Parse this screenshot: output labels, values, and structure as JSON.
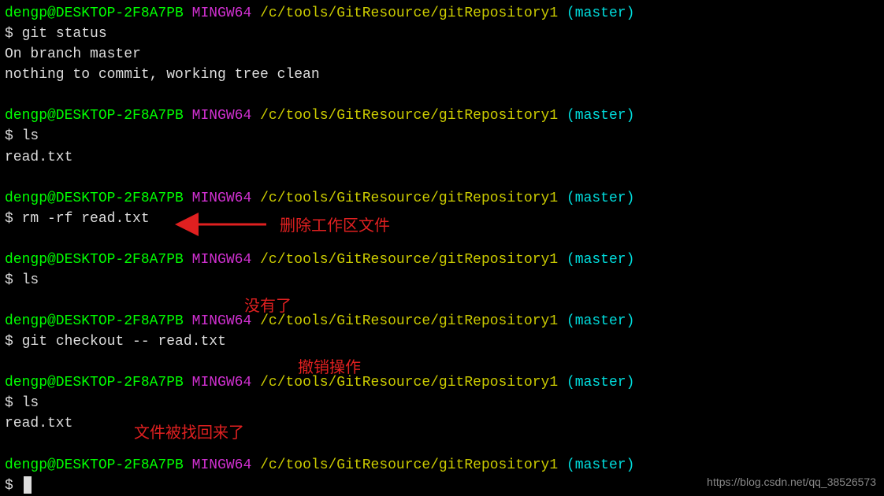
{
  "prompt": {
    "user": "dengp@DESKTOP-2F8A7PB",
    "env": "MINGW64",
    "path": "/c/tools/GitResource/gitRepository1",
    "branch": "(master)",
    "symbol": "$"
  },
  "block1": {
    "cmd": "git status",
    "out1": "On branch master",
    "out2": "nothing to commit, working tree clean"
  },
  "block2": {
    "cmd": "ls",
    "out1": "read.txt"
  },
  "block3": {
    "cmd": "rm -rf read.txt"
  },
  "block4": {
    "cmd": "ls"
  },
  "block5": {
    "cmd": "git checkout -- read.txt"
  },
  "block6": {
    "cmd": "ls",
    "out1": "read.txt"
  },
  "block7": {
    "cmd": ""
  },
  "annotations": {
    "a1": "删除工作区文件",
    "a2": "没有了",
    "a3": "撤销操作",
    "a4": "文件被找回来了"
  },
  "watermark": "https://blog.csdn.net/qq_38526573"
}
